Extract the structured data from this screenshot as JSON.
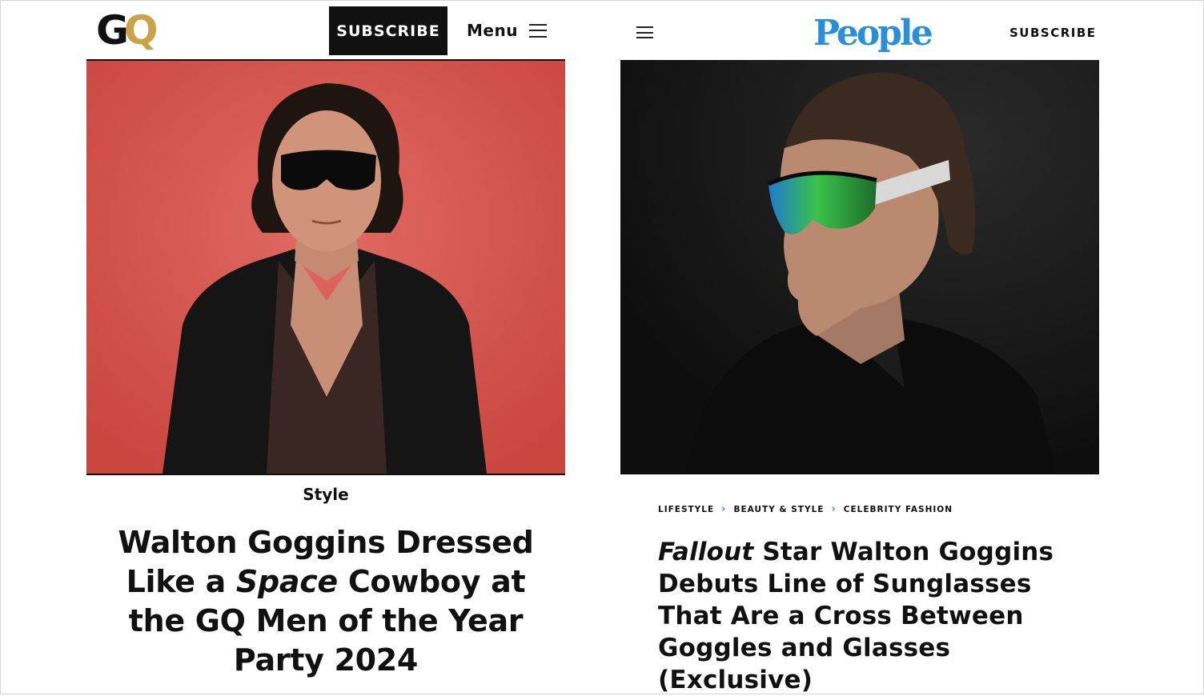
{
  "gq": {
    "logo": {
      "g": "G",
      "q": "Q"
    },
    "subscribe_label": "SUBSCRIBE",
    "menu_label": "Menu",
    "category": "Style",
    "headline": {
      "part1": "Walton Goggins Dressed Like a ",
      "italic": "Space",
      "part2": " Cowboy at the GQ Men of the Year Party 2024"
    },
    "colors": {
      "brand_gold": "#c9a24a",
      "photo_background": "#d6544f"
    }
  },
  "people": {
    "logo": "People",
    "subscribe_label": "SUBSCRIBE",
    "breadcrumb": [
      "LIFESTYLE",
      "BEAUTY & STYLE",
      "CELEBRITY FASHION"
    ],
    "headline": {
      "italic": "Fallout",
      "rest": " Star Walton Goggins Debuts Line of Sunglasses That Are a Cross Between Goggles and Glasses (Exclusive)"
    },
    "colors": {
      "brand_blue": "#2a8fd8",
      "photo_background": "#151515",
      "lens_green": "#39c24a"
    }
  },
  "icons": {
    "menu": "hamburger-icon",
    "breadcrumb_separator": "chevron-right-icon"
  }
}
